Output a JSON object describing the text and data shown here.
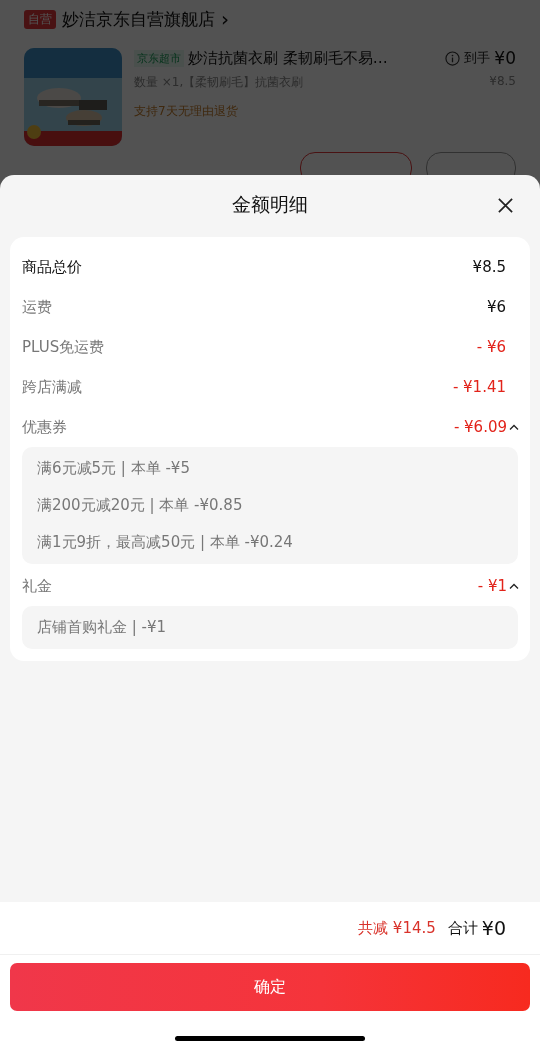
{
  "store": {
    "badge": "自营",
    "name": "妙洁京东自营旗舰店",
    "chevron": "›"
  },
  "product": {
    "tag": "京东超市",
    "title": "妙洁抗菌衣刷 柔韧刷毛不易…",
    "final_label": "到手",
    "final_price": "¥0",
    "spec": "数量 ×1,【柔韧刷毛】抗菌衣刷",
    "price": "¥8.5",
    "service": "支持7天无理由退货"
  },
  "sheet": {
    "title": "金额明细",
    "rows": [
      {
        "label": "商品总价",
        "value": "¥8.5",
        "kind": "total"
      },
      {
        "label": "运费",
        "value": "¥6",
        "kind": "charge"
      },
      {
        "label": "PLUS免运费",
        "value": "- ¥6",
        "kind": "deduction"
      },
      {
        "label": "跨店满减",
        "value": "- ¥1.41",
        "kind": "deduction"
      },
      {
        "label": "优惠券",
        "value": "- ¥6.09",
        "kind": "deduction",
        "expanded": true,
        "details": [
          "满6元减5元 | 本单 -¥5",
          "满200元减20元 | 本单 -¥0.85",
          "满1元9折，最高减50元 | 本单 -¥0.24"
        ]
      },
      {
        "label": "礼金",
        "value": "- ¥1",
        "kind": "deduction",
        "expanded": true,
        "details": [
          "店铺首购礼金 | -¥1"
        ]
      }
    ],
    "saved": "共减 ¥14.5",
    "total_label": "合计",
    "total": "¥0",
    "confirm": "确定"
  }
}
